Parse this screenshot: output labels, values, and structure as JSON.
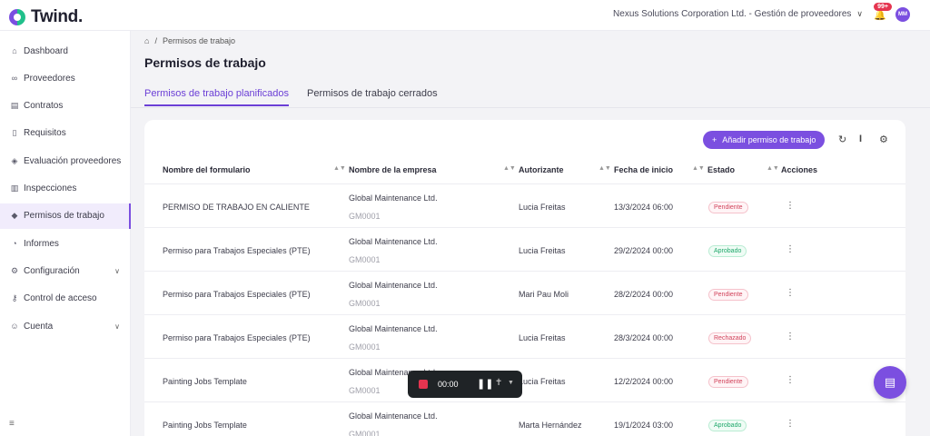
{
  "app": {
    "logo_text": "Twind."
  },
  "topbar": {
    "company": "Nexus Solutions Corporation Ltd. - Gestión de proveedores",
    "notif_count": "99+",
    "avatar_initials": "MM"
  },
  "sidebar": {
    "items": [
      {
        "label": "Dashboard",
        "icon": "home-icon"
      },
      {
        "label": "Proveedores",
        "icon": "link-icon"
      },
      {
        "label": "Contratos",
        "icon": "contract-icon"
      },
      {
        "label": "Requisitos",
        "icon": "document-icon"
      },
      {
        "label": "Evaluación proveedores",
        "icon": "shield-check-icon"
      },
      {
        "label": "Inspecciones",
        "icon": "clipboard-icon"
      },
      {
        "label": "Permisos de trabajo",
        "icon": "shield-icon",
        "active": true
      },
      {
        "label": "Informes",
        "icon": "pie-chart-icon"
      },
      {
        "label": "Configuración",
        "icon": "gear-icon",
        "expandable": true
      },
      {
        "label": "Control de acceso",
        "icon": "key-icon"
      },
      {
        "label": "Cuenta",
        "icon": "user-circle-icon",
        "expandable": true
      }
    ]
  },
  "breadcrumb": {
    "current": "Permisos de trabajo"
  },
  "page": {
    "title": "Permisos de trabajo"
  },
  "tabs": [
    {
      "label": "Permisos de trabajo planificados",
      "active": true
    },
    {
      "label": "Permisos de trabajo cerrados",
      "active": false
    }
  ],
  "toolbar": {
    "add_label": "Añadir permiso de trabajo"
  },
  "table": {
    "headers": [
      "Nombre del formulario",
      "Nombre de la empresa",
      "Autorizante",
      "Fecha de inicio",
      "Estado",
      "Acciones"
    ],
    "rows": [
      {
        "form": "PERMISO DE TRABAJO EN CALIENTE",
        "company": "Global Maintenance Ltd.",
        "code": "GM0001",
        "auth": "Lucia Freitas",
        "date": "13/3/2024 06:00",
        "status": "Pendiente",
        "status_type": "pend"
      },
      {
        "form": "Permiso para Trabajos Especiales (PTE)",
        "company": "Global Maintenance Ltd.",
        "code": "GM0001",
        "auth": "Lucia Freitas",
        "date": "29/2/2024 00:00",
        "status": "Aprobado",
        "status_type": "apro"
      },
      {
        "form": "Permiso para Trabajos Especiales (PTE)",
        "company": "Global Maintenance Ltd.",
        "code": "GM0001",
        "auth": "Mari Pau Moli",
        "date": "28/2/2024 00:00",
        "status": "Pendiente",
        "status_type": "pend"
      },
      {
        "form": "Permiso para Trabajos Especiales (PTE)",
        "company": "Global Maintenance Ltd.",
        "code": "GM0001",
        "auth": "Lucia Freitas",
        "date": "28/3/2024 00:00",
        "status": "Rechazado",
        "status_type": "rech"
      },
      {
        "form": "Painting Jobs Template",
        "company": "Global Maintenance Ltd.",
        "code": "GM0001",
        "auth": "Lucia Freitas",
        "date": "12/2/2024 00:00",
        "status": "Pendiente",
        "status_type": "pend"
      },
      {
        "form": "Painting Jobs Template",
        "company": "Global Maintenance Ltd.",
        "code": "GM0001",
        "auth": "Marta Hernández",
        "date": "19/1/2024 03:00",
        "status": "Aprobado",
        "status_type": "apro"
      }
    ]
  },
  "recorder": {
    "time": "00:00"
  },
  "colors": {
    "accent": "#7b4fe0",
    "approved": "#1fa86b",
    "pending": "#d1435b"
  }
}
